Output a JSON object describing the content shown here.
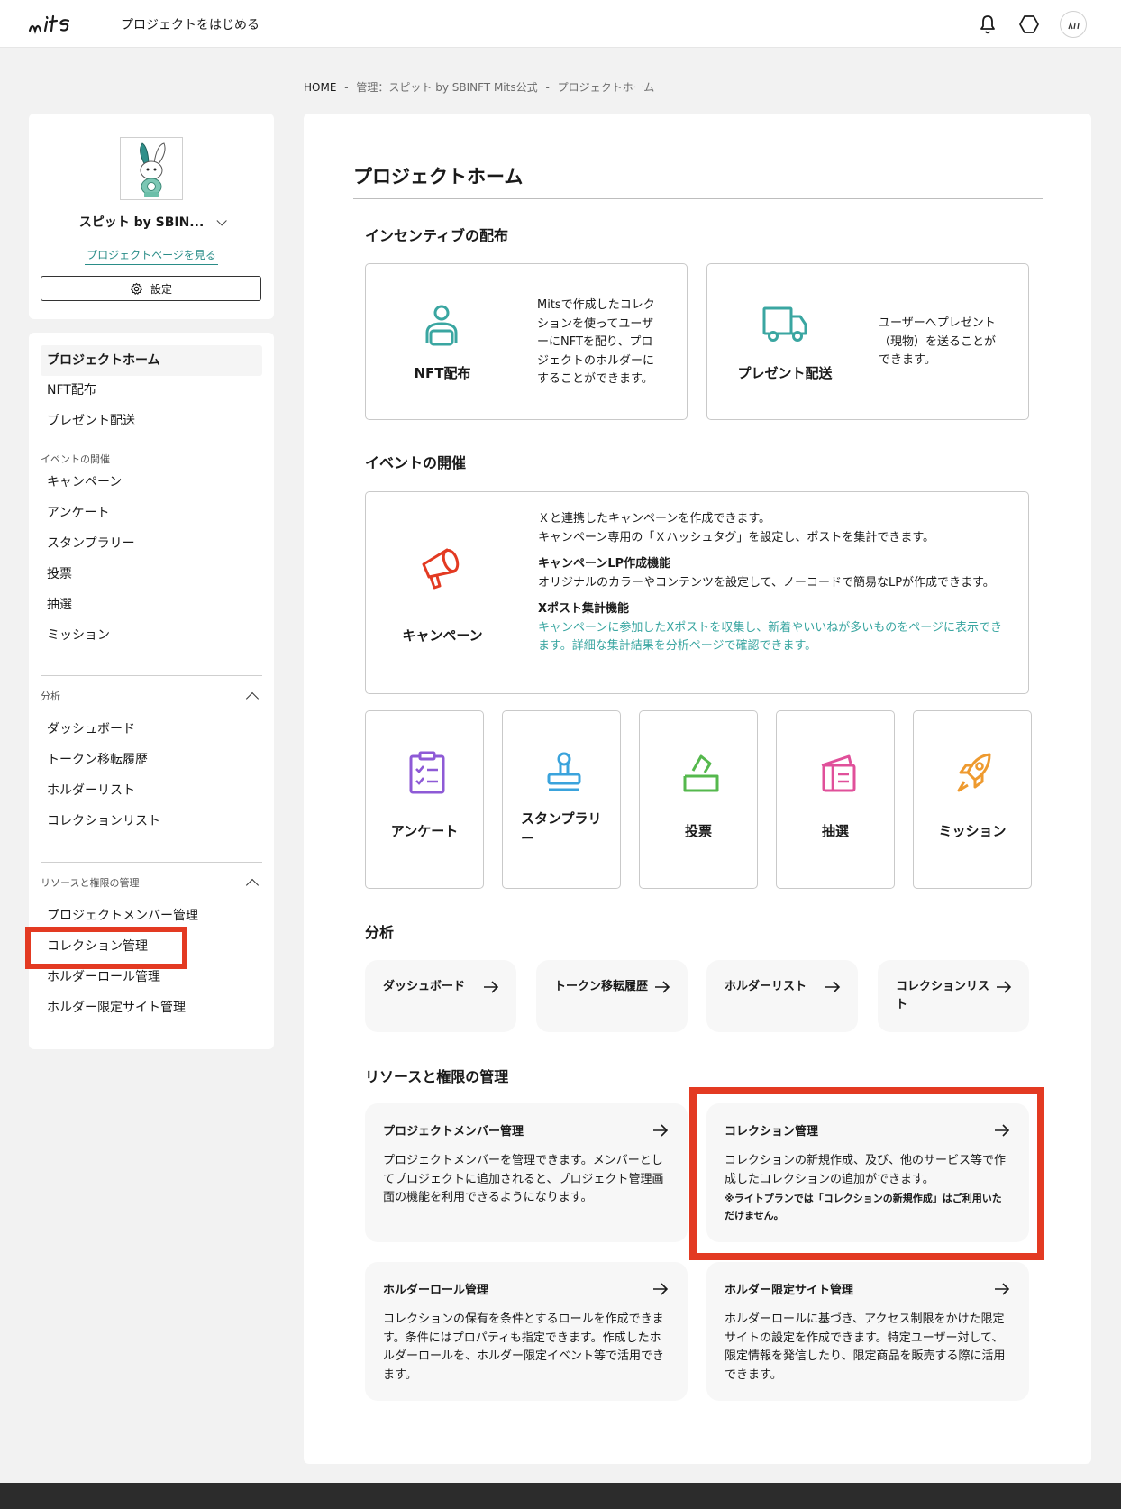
{
  "header": {
    "logo_text": "mits",
    "start_link": "プロジェクトをはじめる",
    "icons": [
      "bell-icon",
      "hexagon-icon",
      "avatar-icon"
    ]
  },
  "breadcrumb": {
    "home": "HOME",
    "sep": "-",
    "mid": "管理：スピット by SBINFT Mits公式",
    "current": "プロジェクトホーム"
  },
  "sidebar": {
    "project_name": "スピット by SBIN...",
    "project_link": "プロジェクトページを見る",
    "settings_label": "設定",
    "items_top": [
      "プロジェクトホーム",
      "NFT配布",
      "プレゼント配送"
    ],
    "group_event": "イベントの開催",
    "items_event": [
      "キャンペーン",
      "アンケート",
      "スタンプラリー",
      "投票",
      "抽選",
      "ミッション"
    ],
    "group_analysis": "分析",
    "items_analysis": [
      "ダッシュボード",
      "トークン移転履歴",
      "ホルダーリスト",
      "コレクションリスト"
    ],
    "group_resource": "リソースと権限の管理",
    "items_resource": [
      "プロジェクトメンバー管理",
      "コレクション管理",
      "ホルダーロール管理",
      "ホルダー限定サイト管理"
    ]
  },
  "main": {
    "title": "プロジェクトホーム",
    "section_incentive": "インセンティブの配布",
    "nft": {
      "label": "NFT配布",
      "desc": "Mitsで作成したコレクションを使ってユーザーにNFTを配り、プロジェクトのホルダーにすることができます。"
    },
    "present": {
      "label": "プレゼント配送",
      "desc": "ユーザーへプレゼント（現物）を送ることができます。"
    },
    "section_event": "イベントの開催",
    "campaign": {
      "label": "キャンペーン",
      "line1": "Ｘと連携したキャンペーンを作成できます。",
      "line2": "キャンペーン専用の「Ｘハッシュタグ」を設定し、ポストを集計できます。",
      "h1": "キャンペーンLP作成機能",
      "d1": "オリジナルのカラーやコンテンツを設定して、ノーコードで簡易なLPが作成できます。",
      "h2": "Xポスト集計機能",
      "d2": "キャンペーンに参加したXポストを収集し、新着やいいねが多いものをページに表示できます。詳細な集計結果を分析ページで確認できます。"
    },
    "event_tiles": [
      {
        "label": "アンケート",
        "icon": "clipboard-check-icon",
        "color": "#8e5ad6"
      },
      {
        "label": "スタンプラリー",
        "icon": "stamp-icon",
        "color": "#3aa3dc"
      },
      {
        "label": "投票",
        "icon": "ballot-box-icon",
        "color": "#55b84d"
      },
      {
        "label": "抽選",
        "icon": "lottery-ticket-icon",
        "color": "#e0509a"
      },
      {
        "label": "ミッション",
        "icon": "rocket-icon",
        "color": "#ee9a2f"
      }
    ],
    "section_analysis": "分析",
    "analysis": [
      "ダッシュボード",
      "トークン移転履歴",
      "ホルダーリスト",
      "コレクションリスト"
    ],
    "section_resource": "リソースと権限の管理",
    "resources": [
      {
        "label": "プロジェクトメンバー管理",
        "desc": "プロジェクトメンバーを管理できます。メンバーとしてプロジェクトに追加されると、プロジェクト管理画面の機能を利用できるようになります。",
        "note": ""
      },
      {
        "label": "コレクション管理",
        "desc": "コレクションの新規作成、及び、他のサービス等で作成したコレクションの追加ができます。",
        "note": "※ライトプランでは「コレクションの新規作成」はご利用いただけません。"
      },
      {
        "label": "ホルダーロール管理",
        "desc": "コレクションの保有を条件とするロールを作成できます。条件にはプロパティも指定できます。作成したホルダーロールを、ホルダー限定イベント等で活用できます。",
        "note": ""
      },
      {
        "label": "ホルダー限定サイト管理",
        "desc": "ホルダーロールに基づき、アクセス制限をかけた限定サイトの設定を作成できます。特定ユーザー対して、限定情報を発信したり、限定商品を販売する際に活用できます。",
        "note": ""
      }
    ]
  },
  "colors": {
    "accent_teal": "#3aa6a1",
    "campaign_red": "#e33a22",
    "highlight_red": "#e33a22"
  }
}
